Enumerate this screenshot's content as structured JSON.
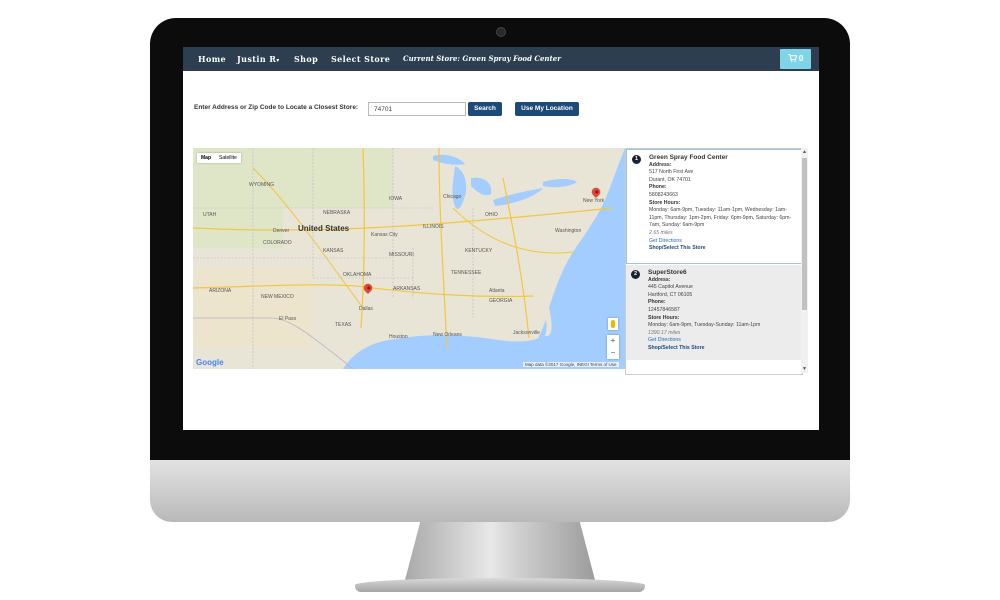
{
  "nav": {
    "home": "Home",
    "user": "Justin R",
    "user_caret": "▾",
    "shop": "Shop",
    "select_store": "Select Store",
    "current_store": "Current Store: Green Spray Food Center",
    "cart_icon": "cart-icon",
    "cart_count": "0"
  },
  "search": {
    "label": "Enter Address or Zip Code to Locate a Closest Store:",
    "value": "74701",
    "search_button": "Search",
    "location_button": "Use My Location"
  },
  "map": {
    "type_map": "Map",
    "type_satellite": "Satellite",
    "country": "United States",
    "zoom_in": "+",
    "zoom_out": "−",
    "google": "Google",
    "footer": "Map data ©2017 Google, INEGI   Terms of Use",
    "labels": {
      "wyoming": "WYOMING",
      "nebraska": "NEBRASKA",
      "iowa": "IOWA",
      "illinois": "ILLINOIS",
      "ohio": "OHIO",
      "colorado": "COLORADO",
      "kansas": "KANSAS",
      "missouri": "MISSOURI",
      "kentucky": "KENTUCKY",
      "utah": "UTAH",
      "oklahoma": "OKLAHOMA",
      "arkansas": "ARKANSAS",
      "tennessee": "TENNESSEE",
      "arizona": "ARIZONA",
      "new_mexico": "NEW MEXICO",
      "texas": "TEXAS",
      "georgia": "GEORGIA",
      "chicago": "Chicago",
      "kansas_city": "Kansas City",
      "dallas": "Dallas",
      "el_paso": "El Paso",
      "houston": "Houston",
      "atlanta": "Atlanta",
      "jacksonville": "Jacksonville",
      "new_orleans": "New Orleans",
      "denver": "Denver",
      "washington": "Washington",
      "new_york": "New York"
    }
  },
  "stores": [
    {
      "num": "1",
      "name": "Green Spray Food Center",
      "address_label": "Address:",
      "address1": "517 North First Ave",
      "address2": "Durant, OK 74701",
      "phone_label": "Phone:",
      "phone": "5808243663",
      "hours_label": "Store Hours:",
      "hours": "Monday: 6am-9pm, Tuesday: 11am-1pm, Wednesday: 1am-11pm, Thursday: 1pm-2pm, Friday: 6pm-9pm, Saturday: 6pm-7am, Sunday: 6am-9pm",
      "miles": "2.65 miles",
      "directions": "Get Directions",
      "select": "Shop/Select This Store"
    },
    {
      "num": "2",
      "name": "SuperStore6",
      "address_label": "Address:",
      "address1": "445 Capitol Avenue",
      "address2": "Hartford, CT 06105",
      "phone_label": "Phone:",
      "phone": "12457846587",
      "hours_label": "Store Hours:",
      "hours": "Monday: 6am-9pm, Tuesday-Sunday: 11am-1pm",
      "miles": "1390.17 miles",
      "directions": "Get Directions",
      "select": "Shop/Select This Store"
    }
  ],
  "colors": {
    "nav_bg": "#2c3e50",
    "cart_bg": "#7fd4ea",
    "button_bg": "#1e4a7a",
    "marker": "#ea4335",
    "water": "#a3ccff"
  }
}
